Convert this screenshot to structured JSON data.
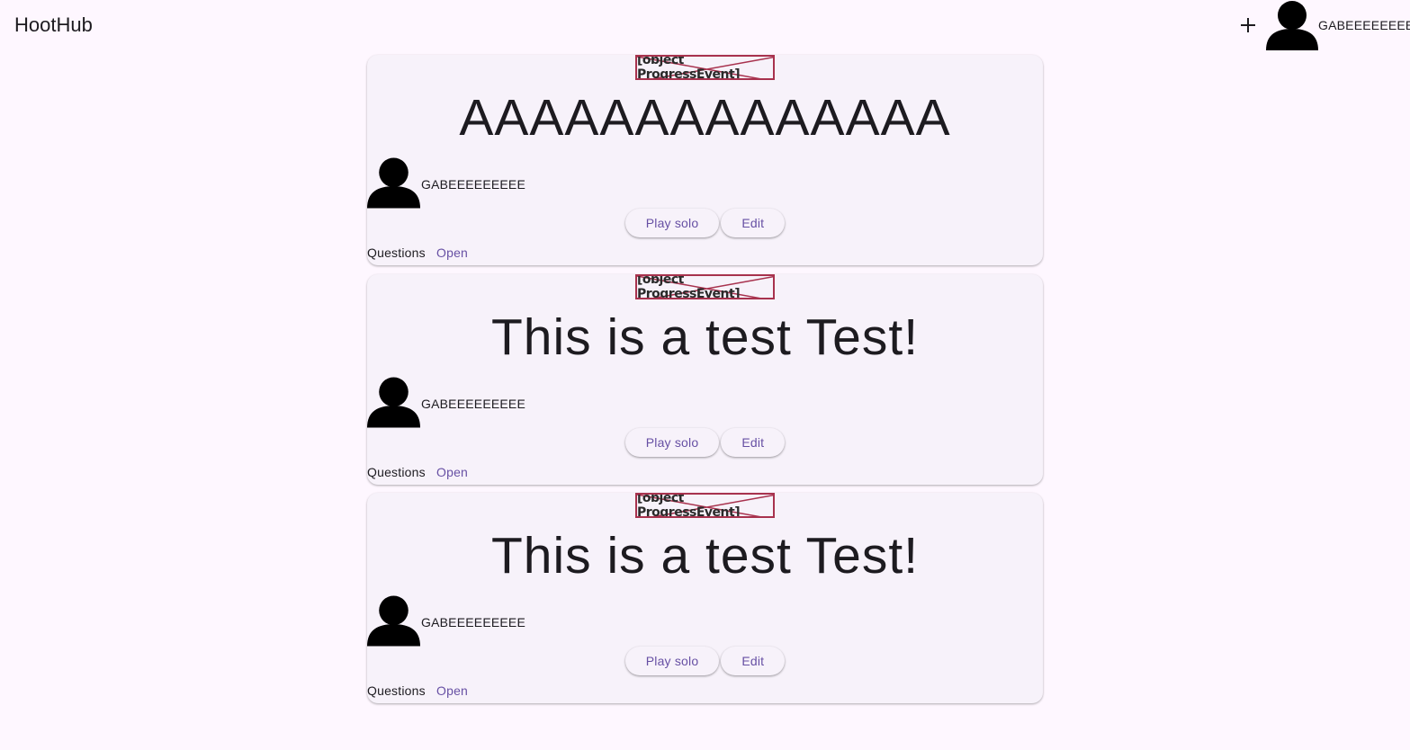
{
  "app": {
    "title": "HootHub",
    "username": "GABEEEEEEEEE"
  },
  "icons": {
    "add": "plus-icon",
    "avatar": "person-icon",
    "broken_image": "broken-image-icon"
  },
  "colors": {
    "background": "#fef7ff",
    "card": "#f7f2fa",
    "accent": "#6750a4",
    "broken_border": "#a8324e"
  },
  "cards": [
    {
      "image_alt": "[object ProgressEvent]",
      "title": "AAAAAAAAAAAAAA",
      "author": "GABEEEEEEEEE",
      "play_label": "Play solo",
      "edit_label": "Edit",
      "questions_label": "Questions",
      "open_label": "Open"
    },
    {
      "image_alt": "[object ProgressEvent]",
      "title": "This is a test Test!",
      "author": "GABEEEEEEEEE",
      "play_label": "Play solo",
      "edit_label": "Edit",
      "questions_label": "Questions",
      "open_label": "Open"
    },
    {
      "image_alt": "[object ProgressEvent]",
      "title": "This is a test Test!",
      "author": "GABEEEEEEEEE",
      "play_label": "Play solo",
      "edit_label": "Edit",
      "questions_label": "Questions",
      "open_label": "Open"
    }
  ]
}
